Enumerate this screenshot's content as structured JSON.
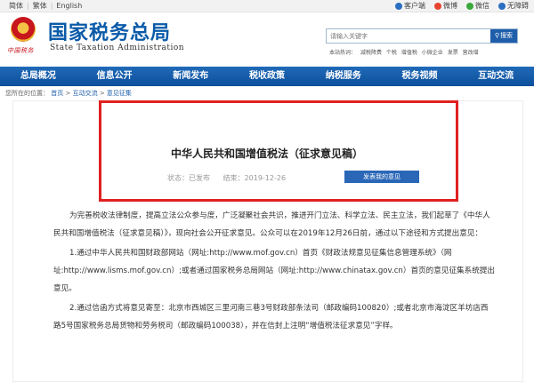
{
  "topbar": {
    "langs": [
      "简体",
      "繁体",
      "English"
    ],
    "apps": [
      {
        "label": "客户端",
        "icon": "client-icon",
        "color": "#2a6fc0"
      },
      {
        "label": "微博",
        "icon": "weibo-icon",
        "color": "#e8432e"
      },
      {
        "label": "微信",
        "icon": "wechat-icon",
        "color": "#3aa83a"
      },
      {
        "label": "无障碍",
        "icon": "accessibility-icon",
        "color": "#2a6fc0"
      }
    ]
  },
  "header": {
    "title": "国家税务总局",
    "subtitle": "State Taxation Administration",
    "emblem_caption": "中国税务",
    "search_placeholder": "请输入关键字",
    "search_button": "搜索",
    "hot_label": "本站热词：",
    "hot_words": [
      "减税降费",
      "个税",
      "增值税",
      "小微企业",
      "发票",
      "营改增"
    ]
  },
  "nav": [
    "总局概况",
    "信息公开",
    "新闻发布",
    "税收政策",
    "纳税服务",
    "税务视频",
    "互动交流"
  ],
  "breadcrumb": {
    "prefix": "您所在的位置：",
    "items": [
      "首页",
      "互动交流",
      "意见征集"
    ],
    "sep": ">"
  },
  "document": {
    "title": "中华人民共和国增值税法（征求意见稿）",
    "status": "状态：已发布",
    "end_date": "结束：2019-12-26",
    "opinion_button": "发表我的意见",
    "paragraphs": [
      "为完善税收法律制度，提高立法公众参与度，广泛凝聚社会共识，推进开门立法、科学立法、民主立法，我们起草了《中华人民共和国增值税法（征求意见稿）》，现向社会公开征求意见。公众可以在2019年12月26日前，通过以下途径和方式提出意见：",
      "1.通过中华人民共和国财政部网站（网址:http://www.mof.gov.cn）首页《财政法规意见征集信息管理系统》（网址:http://www.lisms.mof.gov.cn）;或者通过国家税务总局网站（网址:http://www.chinatax.gov.cn）首页的意见征集系统提出意见。",
      "2.通过信函方式将意见寄至：北京市西城区三里河南三巷3号财政部条法司（邮政编码100820）;或者北京市海淀区羊坊店西路5号国家税务总局货物和劳务税司（邮政编码100038），并在信封上注明“增值税法征求意见”字样。"
    ]
  },
  "colors": {
    "brand_blue": "#0a5aa8",
    "nav_blue": "#1a5fad",
    "highlight_red": "#e02020",
    "button_blue": "#2a67b7"
  }
}
